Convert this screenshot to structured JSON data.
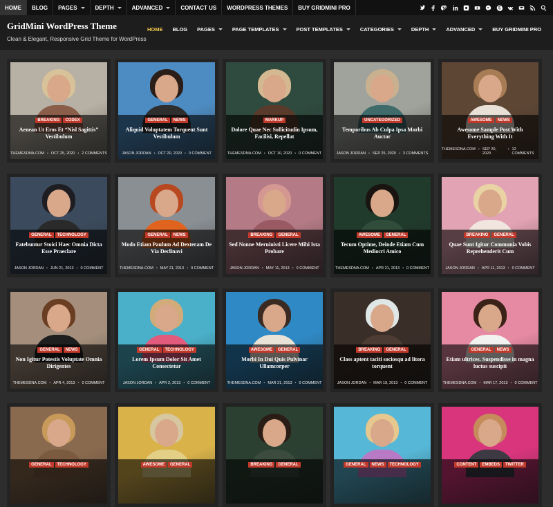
{
  "topnav": [
    {
      "label": "Home",
      "active": true,
      "caret": false
    },
    {
      "label": "Blog",
      "active": false,
      "caret": false
    },
    {
      "label": "Pages",
      "active": false,
      "caret": true
    },
    {
      "label": "Depth",
      "active": false,
      "caret": true
    },
    {
      "label": "Advanced",
      "active": false,
      "caret": true
    },
    {
      "label": "Contact Us",
      "active": false,
      "caret": false
    },
    {
      "label": "WordPress Themes",
      "active": false,
      "caret": false
    },
    {
      "label": "Buy GridMini Pro",
      "active": false,
      "caret": false
    }
  ],
  "social_icons": [
    "twitter-icon",
    "facebook-icon",
    "pinterest-icon",
    "linkedin-icon",
    "instagram-icon",
    "youtube-icon",
    "messenger-icon",
    "skype-icon",
    "vk-icon",
    "email-icon",
    "rss-icon",
    "search-icon"
  ],
  "site": {
    "title": "GridMini WordPress Theme",
    "description": "Clean & Elegant, Responsive Grid Theme for WordPress"
  },
  "mainnav": [
    {
      "label": "Home",
      "active": true,
      "caret": false
    },
    {
      "label": "Blog",
      "active": false,
      "caret": false
    },
    {
      "label": "Pages",
      "active": false,
      "caret": true
    },
    {
      "label": "Page Templates",
      "active": false,
      "caret": true
    },
    {
      "label": "Post Templates",
      "active": false,
      "caret": true
    },
    {
      "label": "Categories",
      "active": false,
      "caret": true
    },
    {
      "label": "Depth",
      "active": false,
      "caret": true
    },
    {
      "label": "Advanced",
      "active": false,
      "caret": true
    },
    {
      "label": "Buy GridMini Pro",
      "active": false,
      "caret": false
    }
  ],
  "colors": {
    "accent": "#f2c94c",
    "category_badge": "#c0392b"
  },
  "posts": [
    {
      "title": "Aenean Ut Eros Et “Nisl Sagittis” Vestibulum",
      "cats": [
        "Breaking",
        "Codex"
      ],
      "author": "ThemesDNA.com",
      "date": "Oct 25, 2020",
      "comments": "2 Comments",
      "bg": "#b7b0a4",
      "hair": "#d8c29a",
      "body": "#8b5e4a"
    },
    {
      "title": "Aliquid Voluptatem Torquent Sunt Vestibulum",
      "cats": [
        "General",
        "News"
      ],
      "author": "Jason Jordan",
      "date": "Oct 20, 2020",
      "comments": "0 Comment",
      "bg": "#4d8cc2",
      "hair": "#2b1d18",
      "body": "#2e2e2e"
    },
    {
      "title": "Dolore Quae Nec Sollicitudin Ipsum, Facilisi, Repellat",
      "cats": [
        "Markup"
      ],
      "author": "ThemesDNA.com",
      "date": "Oct 10, 2020",
      "comments": "0 Comment",
      "bg": "#2f4a3e",
      "hair": "#d4b891",
      "body": "#5a3b2b"
    },
    {
      "title": "Temporibus Ab Culpa Ipsa Morbi Auctor",
      "cats": [
        "Uncategorized"
      ],
      "author": "Jason Jordan",
      "date": "Sep 25, 2020",
      "comments": "3 Comments",
      "bg": "#9fa39b",
      "hair": "#c9b08e",
      "body": "#3f6b6a"
    },
    {
      "title": "Awesome Sample Post With Everything With It",
      "cats": [
        "Awesome",
        "News"
      ],
      "author": "ThemesDNA.com",
      "date": "Sep 20, 2020",
      "comments": "12 Comments",
      "bg": "#5e4634",
      "hair": "#a87c55",
      "body": "#e8e0d6"
    },
    {
      "title": "Fatebuntur Stoici Haec Omnia Dicta Esse Praeclare",
      "cats": [
        "General",
        "Technology"
      ],
      "author": "Jason Jordan",
      "date": "Jun 21, 2013",
      "comments": "0 Comment",
      "bg": "#3b4a5c",
      "hair": "#1e1e22",
      "body": "#2a2a2a"
    },
    {
      "title": "Modo Etiam Paulum Ad Dexteram De Via Declinavi",
      "cats": [
        "General",
        "News"
      ],
      "author": "ThemesDNA.com",
      "date": "May 21, 2013",
      "comments": "0 Comment",
      "bg": "#8a8f94",
      "hair": "#b8481f",
      "body": "#e0631e"
    },
    {
      "title": "Sed Nonne Merninisti Licere Mihi Ista Probare",
      "cats": [
        "Breaking",
        "General"
      ],
      "author": "Jason Jordan",
      "date": "May 11, 2013",
      "comments": "0 Comment",
      "bg": "#b47b86",
      "hair": "#d59792",
      "body": "#9a5a63"
    },
    {
      "title": "Tecum Optime, Deinde Etiam Cum Mediocri Amico",
      "cats": [
        "Awesome",
        "General"
      ],
      "author": "ThemesDNA.com",
      "date": "Apr 21, 2013",
      "comments": "0 Comment",
      "bg": "#203a2c",
      "hair": "#1a1411",
      "body": "#2f4d3a"
    },
    {
      "title": "Quae Sunt Igitur Communia Vobis Reprehenderit Cum",
      "cats": [
        "Breaking",
        "General"
      ],
      "author": "Jason Jordan",
      "date": "Apr 11, 2013",
      "comments": "0 Comment",
      "bg": "#e2a3b4",
      "hair": "#e9d3a4",
      "body": "#f1e6df"
    },
    {
      "title": "Non Igitur Potestis Voluptate Omnia Dirigentes",
      "cats": [
        "General",
        "News"
      ],
      "author": "ThemesDNA.com",
      "date": "Apr 4, 2013",
      "comments": "0 Comment",
      "bg": "#a58f7c",
      "hair": "#6a3e22",
      "body": "#1f1f1f"
    },
    {
      "title": "Lorem Ipsum Dolor Sit Amet Consectetur",
      "cats": [
        "General",
        "Technology"
      ],
      "author": "Jason Jordan",
      "date": "Apr 2, 2013",
      "comments": "0 Comment",
      "bg": "#4ab0c9",
      "hair": "#d2ab7a",
      "body": "#e25b7c"
    },
    {
      "title": "Morbi In Dui Quis Pulvinar Ullamcorper",
      "cats": [
        "Awesome",
        "General"
      ],
      "author": "ThemesDNA.com",
      "date": "Mar 21, 2013",
      "comments": "0 Comment",
      "bg": "#2f89c4",
      "hair": "#3a2a22",
      "body": "#e9e2d6"
    },
    {
      "title": "Class aptent taciti sociosqu ad litora torquent",
      "cats": [
        "Breaking",
        "General"
      ],
      "author": "Jason Jordan",
      "date": "Mar 19, 2013",
      "comments": "0 Comment",
      "bg": "#3a2e28",
      "hair": "#dfe6e6",
      "body": "#4d3c33"
    },
    {
      "title": "Etiam ultrices. Suspendisse in magna luctus suscipit",
      "cats": [
        "General",
        "News"
      ],
      "author": "ThemesDNA.com",
      "date": "Mar 17, 2013",
      "comments": "0 Comment",
      "bg": "#e68aa3",
      "hair": "#3b2219",
      "body": "#f2f2f0"
    },
    {
      "title": "",
      "cats": [
        "General",
        "Technology"
      ],
      "author": "",
      "date": "",
      "comments": "",
      "bg": "#8a6a4e",
      "hair": "#c89a5a",
      "body": "#7b5a40"
    },
    {
      "title": "",
      "cats": [
        "Awesome",
        "General"
      ],
      "author": "",
      "date": "",
      "comments": "",
      "bg": "#d9b24a",
      "hair": "#d7c7a0",
      "body": "#e3cf86"
    },
    {
      "title": "",
      "cats": [
        "Breaking",
        "General"
      ],
      "author": "",
      "date": "",
      "comments": "",
      "bg": "#2c4032",
      "hair": "#2a1d16",
      "body": "#3b4b3d"
    },
    {
      "title": "",
      "cats": [
        "General",
        "News",
        "Technology"
      ],
      "author": "",
      "date": "",
      "comments": "",
      "bg": "#57b7d6",
      "hair": "#e6c88f",
      "body": "#b87ac4"
    },
    {
      "title": "",
      "cats": [
        "Content",
        "Embeds",
        "Twitter"
      ],
      "author": "",
      "date": "",
      "comments": "",
      "bg": "#d8357c",
      "hair": "#c58b5a",
      "body": "#3e3a44"
    }
  ]
}
